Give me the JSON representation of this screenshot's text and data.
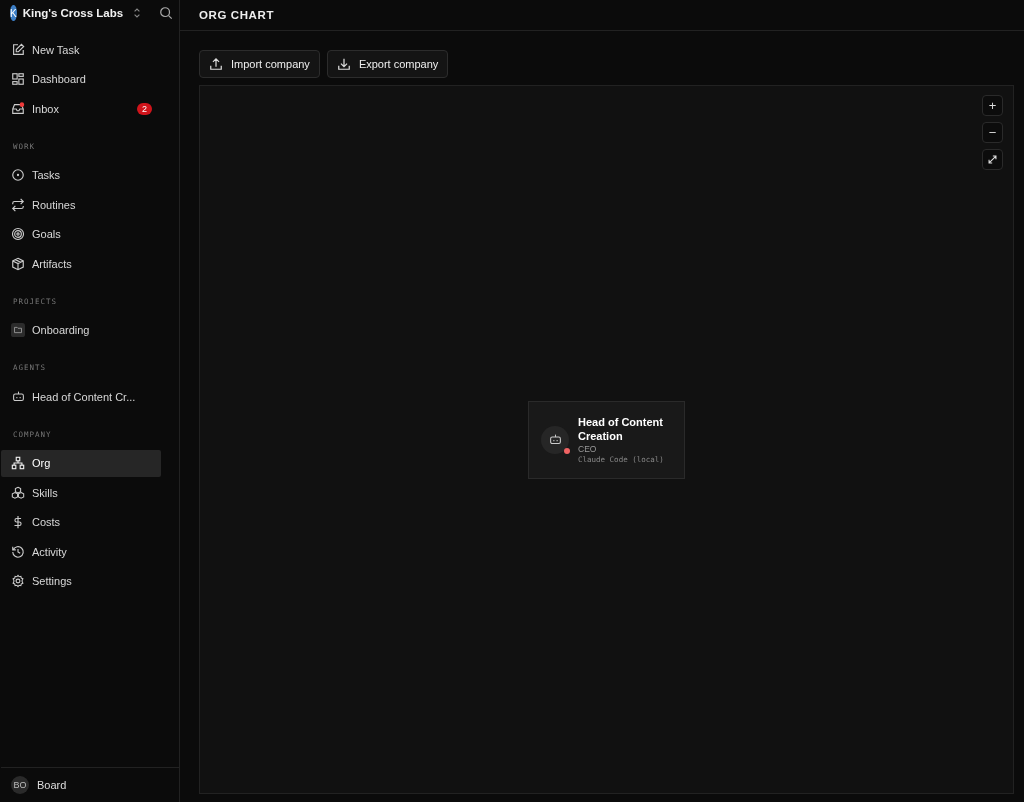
{
  "company": {
    "initial": "K",
    "name": "King's Cross Labs"
  },
  "nav_top": [
    {
      "label": "New Task",
      "selected": false
    },
    {
      "label": "Dashboard",
      "selected": false
    },
    {
      "label": "Inbox",
      "selected": false,
      "badge": "2"
    }
  ],
  "sections": [
    {
      "title": "WORK",
      "items": [
        {
          "label": "Tasks",
          "selected": false
        },
        {
          "label": "Routines",
          "selected": false
        },
        {
          "label": "Goals",
          "selected": false
        },
        {
          "label": "Artifacts",
          "selected": false
        }
      ]
    },
    {
      "title": "PROJECTS",
      "items": [
        {
          "label": "Onboarding",
          "selected": false,
          "kind": "project"
        }
      ]
    },
    {
      "title": "AGENTS",
      "items": [
        {
          "label": "Head of Content Cr...",
          "selected": false,
          "kind": "agent"
        }
      ]
    },
    {
      "title": "COMPANY",
      "items": [
        {
          "label": "Org",
          "selected": true,
          "kind": "org"
        },
        {
          "label": "Skills",
          "selected": false,
          "kind": "skills"
        },
        {
          "label": "Costs",
          "selected": false,
          "kind": "costs"
        },
        {
          "label": "Activity",
          "selected": false,
          "kind": "activity"
        },
        {
          "label": "Settings",
          "selected": false,
          "kind": "settings"
        }
      ]
    }
  ],
  "user": {
    "initials": "BO",
    "name": "Board"
  },
  "page_title": "ORG CHART",
  "actions": [
    {
      "label": "Import company",
      "kind": "import"
    },
    {
      "label": "Export company",
      "kind": "export"
    }
  ],
  "zoom_controls": [
    "+",
    "−"
  ],
  "node": {
    "name": "Head of Content Creation",
    "role": "CEO",
    "adapter": "Claude Code (local)",
    "color": "#f06363"
  }
}
